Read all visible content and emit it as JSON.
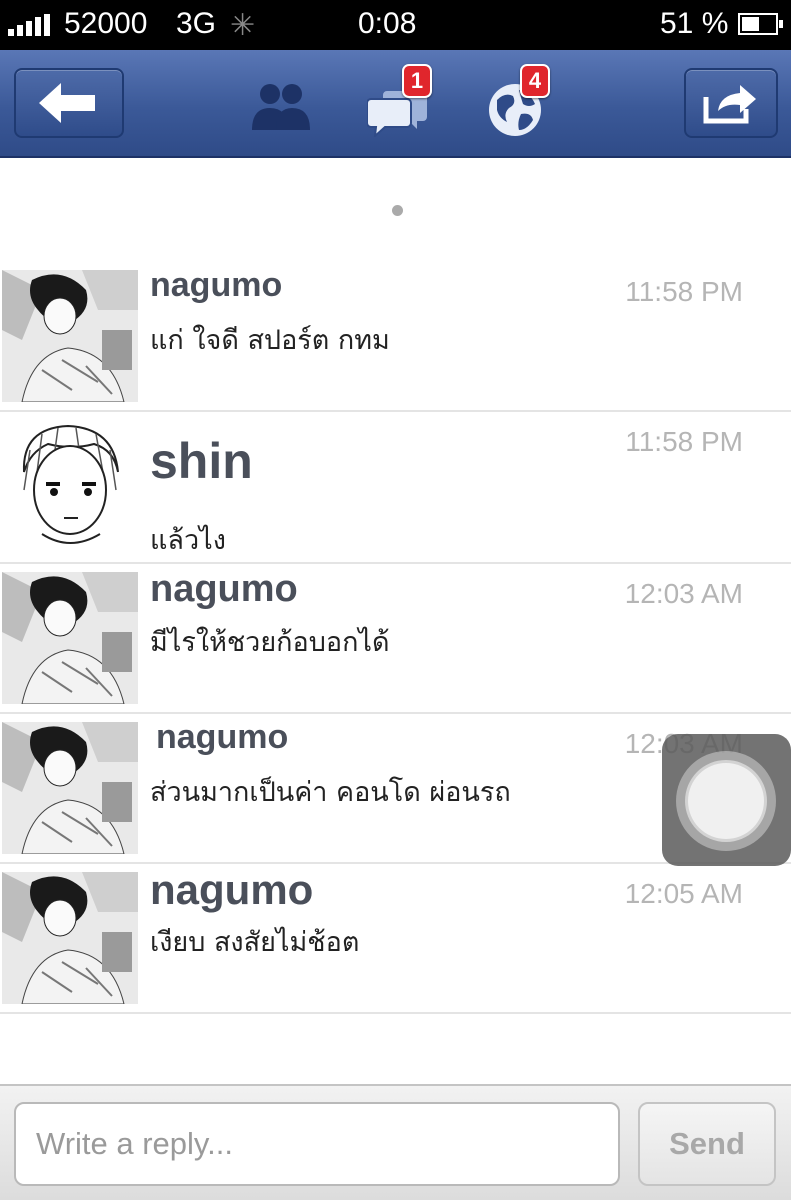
{
  "status_bar": {
    "carrier": "52000",
    "network": "3G",
    "time": "0:08",
    "battery": "51 %",
    "battery_level": 0.51
  },
  "nav": {
    "back_icon": "left-arrow-icon",
    "friends_icon": "friends-icon",
    "messages_icon": "messages-icon",
    "messages_badge": "1",
    "notifications_icon": "globe-icon",
    "notifications_badge": "4",
    "share_icon": "share-icon",
    "accent": "#3b5998",
    "badge_color": "#e0262c"
  },
  "messages": [
    {
      "sender": "nagumo",
      "time": "11:58 PM",
      "text": "แก่ ใจดี สปอร์ต กทม"
    },
    {
      "sender": "shin",
      "time": "11:58 PM",
      "text": "แล้วไง"
    },
    {
      "sender": "nagumo",
      "time": "12:03 AM",
      "text": "มีไรให้ชวยก้อบอกได้"
    },
    {
      "sender": "nagumo",
      "time": "12:03 AM",
      "text": "ส่วนมากเป็นค่า คอนโด ผ่อนรถ"
    },
    {
      "sender": "nagumo",
      "time": "12:05 AM",
      "text": "เงียบ สงสัยไม่ช้อต"
    }
  ],
  "reply": {
    "placeholder": "Write a reply...",
    "send_label": "Send"
  }
}
